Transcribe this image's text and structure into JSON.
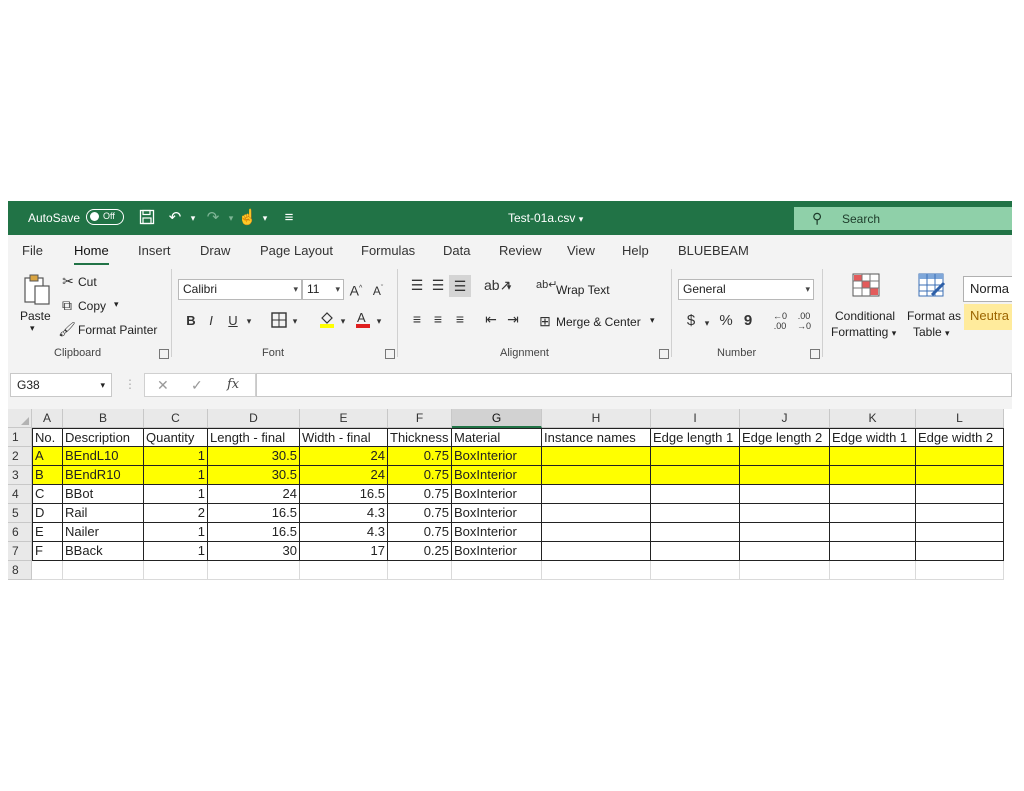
{
  "titlebar": {
    "autosave_label": "AutoSave",
    "autosave_state": "Off",
    "doc_title": "Test-01a.csv",
    "search_placeholder": "Search"
  },
  "tabs": [
    "File",
    "Home",
    "Insert",
    "Draw",
    "Page Layout",
    "Formulas",
    "Data",
    "Review",
    "View",
    "Help",
    "BLUEBEAM"
  ],
  "active_tab": "Home",
  "ribbon": {
    "clipboard": {
      "paste": "Paste",
      "cut": "Cut",
      "copy": "Copy",
      "format_painter": "Format Painter",
      "label": "Clipboard"
    },
    "font": {
      "font_name": "Calibri",
      "font_size": "11",
      "bold": "B",
      "italic": "I",
      "underline": "U",
      "label": "Font"
    },
    "alignment": {
      "wrap_text": "Wrap Text",
      "merge_center": "Merge & Center",
      "label": "Alignment"
    },
    "number": {
      "format": "General",
      "currency": "$",
      "percent": "%",
      "comma": "9",
      "label": "Number"
    },
    "styles": {
      "conditional_1": "Conditional",
      "conditional_2": "Formatting",
      "format_as_1": "Format as",
      "format_as_2": "Table",
      "normal": "Norma",
      "neutral": "Neutra"
    }
  },
  "formula_bar": {
    "name_box": "G38",
    "formula": ""
  },
  "colors": {
    "accent": "#217346",
    "highlight": "#ffff00",
    "neutral_style": "#ffeb9c"
  },
  "columns": [
    "A",
    "B",
    "C",
    "D",
    "E",
    "F",
    "G",
    "H",
    "I",
    "J",
    "K",
    "L"
  ],
  "selected_column": "G",
  "rows": [
    {
      "n": "1",
      "cells": [
        "No.",
        "Description",
        "Quantity",
        "Length - final",
        "Width - final",
        "Thickness",
        "Material",
        "Instance names",
        "Edge length 1",
        "Edge length 2",
        "Edge width 1",
        "Edge width 2"
      ],
      "highlight": false
    },
    {
      "n": "2",
      "cells": [
        "A",
        "BEndL10",
        "1",
        "30.5",
        "24",
        "0.75",
        "BoxInterior",
        "",
        "",
        "",
        "",
        ""
      ],
      "highlight": true
    },
    {
      "n": "3",
      "cells": [
        "B",
        "BEndR10",
        "1",
        "30.5",
        "24",
        "0.75",
        "BoxInterior",
        "",
        "",
        "",
        "",
        ""
      ],
      "highlight": true
    },
    {
      "n": "4",
      "cells": [
        "C",
        "BBot",
        "1",
        "24",
        "16.5",
        "0.75",
        "BoxInterior",
        "",
        "",
        "",
        "",
        ""
      ],
      "highlight": false
    },
    {
      "n": "5",
      "cells": [
        "D",
        "Rail",
        "2",
        "16.5",
        "4.3",
        "0.75",
        "BoxInterior",
        "",
        "",
        "",
        "",
        ""
      ],
      "highlight": false
    },
    {
      "n": "6",
      "cells": [
        "E",
        "Nailer",
        "1",
        "16.5",
        "4.3",
        "0.75",
        "BoxInterior",
        "",
        "",
        "",
        "",
        ""
      ],
      "highlight": false
    },
    {
      "n": "7",
      "cells": [
        "F",
        "BBack",
        "1",
        "30",
        "17",
        "0.25",
        "BoxInterior",
        "",
        "",
        "",
        "",
        ""
      ],
      "highlight": false
    },
    {
      "n": "8",
      "cells": [
        "",
        "",
        "",
        "",
        "",
        "",
        "",
        "",
        "",
        "",
        "",
        ""
      ],
      "highlight": false
    }
  ]
}
